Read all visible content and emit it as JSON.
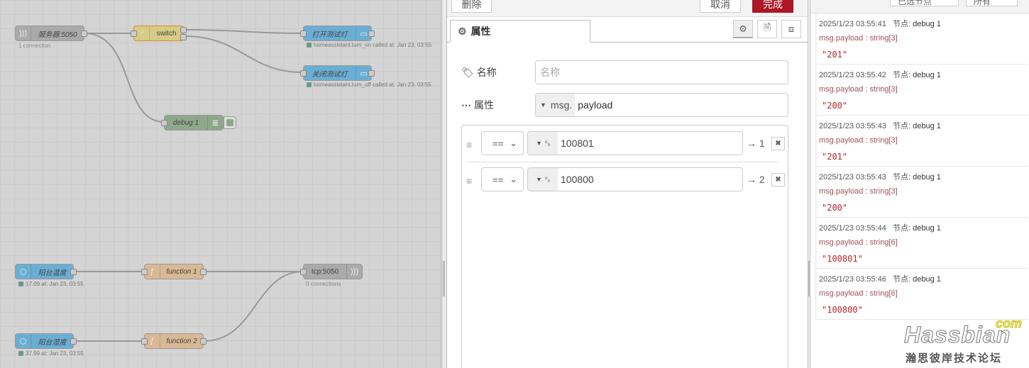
{
  "canvas": {
    "nodes": {
      "tcp_in": {
        "label": "服务器:5050",
        "sub": "1 connection"
      },
      "switch": {
        "label": "switch"
      },
      "on": {
        "label": "打开测试灯",
        "status": "homeassistant.turn_on called at: Jan 23, 03:55"
      },
      "off": {
        "label": "关闭测试灯",
        "status": "homeassistant.turn_off called at: Jan 23, 03:55"
      },
      "debug": {
        "label": "debug 1"
      },
      "temp": {
        "label": "阳台温度",
        "status": "17.09 at: Jan 23, 03:55"
      },
      "hum": {
        "label": "阳台湿度",
        "status": "37.99 at: Jan 23, 03:55"
      },
      "f1": {
        "label": "function 1"
      },
      "f2": {
        "label": "function 2"
      },
      "tcp_out": {
        "label": "tcp:5050",
        "sub": "0 connections"
      }
    },
    "colors": {
      "ha": "#6aaed4",
      "switch": "#d6cc85",
      "function": "#d9b896",
      "debug": "#8fa88c",
      "tcp": "#aaaaaa"
    }
  },
  "editor": {
    "delete_label": "删除",
    "cancel_label": "取消",
    "done_label": "完成",
    "done_color": "#ad1625",
    "tab_label": "属性",
    "name_label": "名称",
    "name_placeholder": "名称",
    "name_value": "",
    "property_label": "属性",
    "property_prefix": "msg.",
    "property_value": "payload",
    "rules": [
      {
        "op": "==",
        "type": "⁰₉",
        "value": "100801",
        "output": "→ 1"
      },
      {
        "op": "==",
        "type": "⁰₉",
        "value": "100800",
        "output": "→ 2"
      }
    ]
  },
  "debug": {
    "filter_label": "已选节点",
    "all_label": "所有",
    "messages": [
      {
        "time": "2025/1/23 03:55:41",
        "node_prefix": "节点:",
        "node": "debug 1",
        "path": "msg.payload : string[3]",
        "value": "\"201\""
      },
      {
        "time": "2025/1/23 03:55:42",
        "node_prefix": "节点:",
        "node": "debug 1",
        "path": "msg.payload : string[3]",
        "value": "\"200\""
      },
      {
        "time": "2025/1/23 03:55:43",
        "node_prefix": "节点:",
        "node": "debug 1",
        "path": "msg.payload : string[3]",
        "value": "\"201\""
      },
      {
        "time": "2025/1/23 03:55:43",
        "node_prefix": "节点:",
        "node": "debug 1",
        "path": "msg.payload : string[3]",
        "value": "\"200\""
      },
      {
        "time": "2025/1/23 03:55:44",
        "node_prefix": "节点:",
        "node": "debug 1",
        "path": "msg.payload : string[6]",
        "value": "\"100801\""
      },
      {
        "time": "2025/1/23 03:55:46",
        "node_prefix": "节点:",
        "node": "debug 1",
        "path": "msg.payload : string[6]",
        "value": "\"100800\""
      }
    ]
  },
  "watermark": {
    "brand": "Hassbian",
    "tld": "com",
    "tagline": "瀚思彼岸技术论坛"
  }
}
